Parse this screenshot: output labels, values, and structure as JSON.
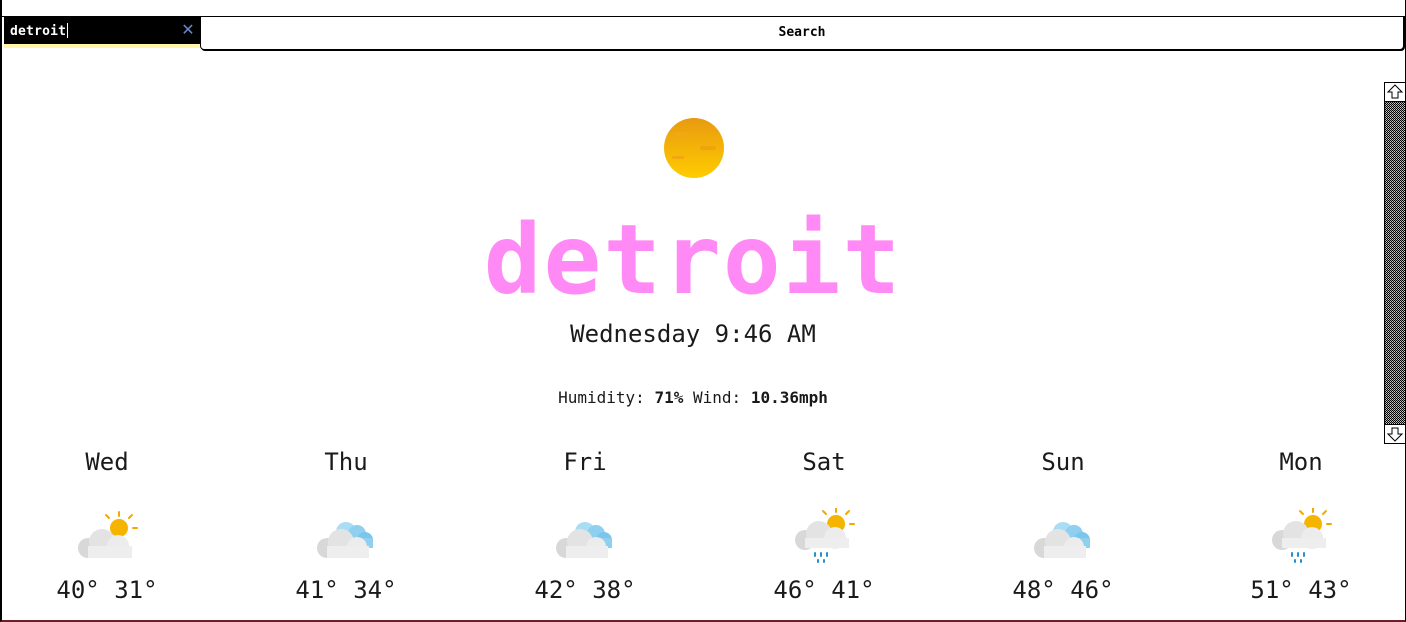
{
  "search": {
    "value": "detroit",
    "button_label": "Search"
  },
  "current": {
    "icon": "sun-haze-icon",
    "city": "detroit",
    "datetime": "Wednesday 9:46 AM",
    "humidity_label": "Humidity:",
    "humidity_value": "71%",
    "wind_label": "Wind:",
    "wind_value": "10.36mph"
  },
  "colors": {
    "city": "#ff8af5",
    "search_underline": "#fff6a8",
    "sun": "#f5b400"
  },
  "forecast": [
    {
      "day": "Wed",
      "icon": "partly-cloudy-sun-icon",
      "high": "40°",
      "low": "31°"
    },
    {
      "day": "Thu",
      "icon": "cloudy-icon",
      "high": "41°",
      "low": "34°"
    },
    {
      "day": "Fri",
      "icon": "cloudy-icon",
      "high": "42°",
      "low": "38°"
    },
    {
      "day": "Sat",
      "icon": "sun-rain-icon",
      "high": "46°",
      "low": "41°"
    },
    {
      "day": "Sun",
      "icon": "cloudy-icon",
      "high": "48°",
      "low": "46°"
    },
    {
      "day": "Mon",
      "icon": "sun-rain-icon",
      "high": "51°",
      "low": "43°"
    }
  ]
}
